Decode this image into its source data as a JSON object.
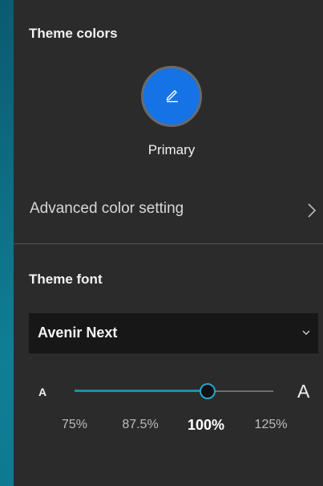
{
  "theme_colors": {
    "title": "Theme colors",
    "primary": {
      "label": "Primary",
      "color": "#1573e6",
      "icon": "pencil-icon"
    },
    "advanced": {
      "label": "Advanced color setting",
      "icon": "chevron-right-icon"
    }
  },
  "theme_font": {
    "title": "Theme font",
    "font_select": {
      "value": "Avenir Next",
      "icon": "chevron-down-icon"
    },
    "size_slider": {
      "small_label": "A",
      "large_label": "A",
      "ticks": [
        "75%",
        "87.5%",
        "100%",
        "125%"
      ],
      "selected": "100%",
      "selected_fraction": 0.67
    }
  },
  "colors": {
    "panel": "#2b2b2b",
    "accent": "#1a8fb0",
    "primary_swatch": "#1573e6"
  }
}
